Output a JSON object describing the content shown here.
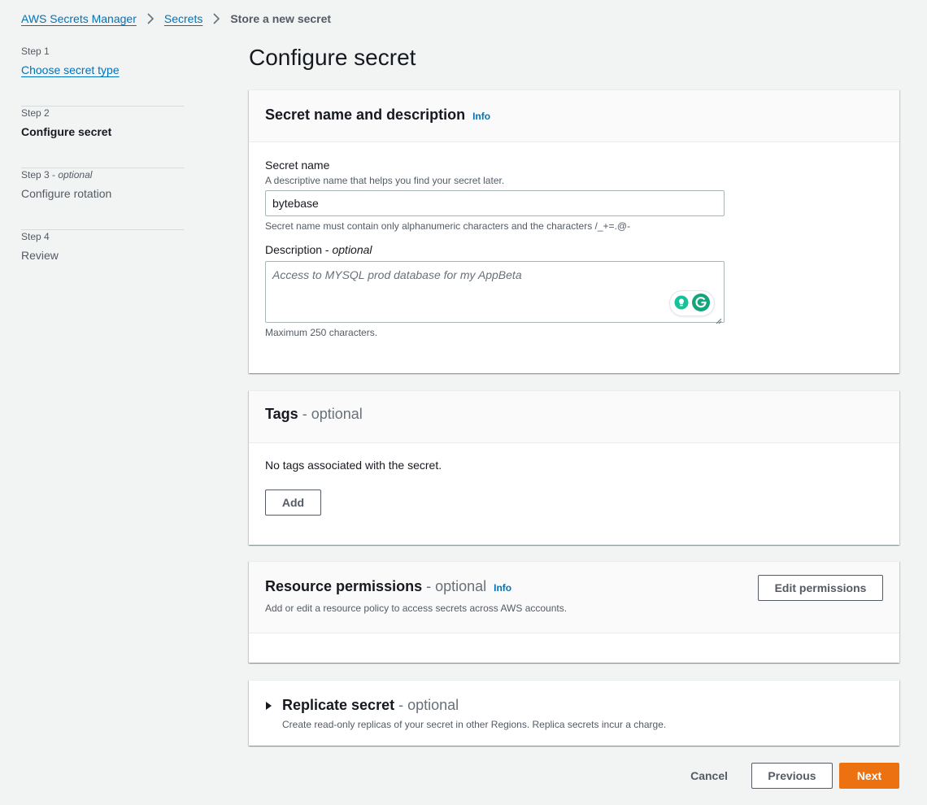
{
  "breadcrumb": {
    "root": "AWS Secrets Manager",
    "secrets": "Secrets",
    "current": "Store a new secret"
  },
  "steps": [
    {
      "label": "Step 1",
      "optional": "",
      "title": "Choose secret type"
    },
    {
      "label": "Step 2",
      "optional": "",
      "title": "Configure secret"
    },
    {
      "label": "Step 3",
      "optional": "optional",
      "title": "Configure rotation"
    },
    {
      "label": "Step 4",
      "optional": "",
      "title": "Review"
    }
  ],
  "page": {
    "title": "Configure secret"
  },
  "secret_name_panel": {
    "title": "Secret name and description",
    "info": "Info",
    "name_label": "Secret name",
    "name_desc": "A descriptive name that helps you find your secret later.",
    "name_value": "bytebase",
    "name_constraint": "Secret name must contain only alphanumeric characters and the characters /_+=.@-",
    "desc_label": "Description",
    "desc_optional": "optional",
    "desc_placeholder": "Access to MYSQL prod database for my AppBeta",
    "desc_constraint": "Maximum 250 characters."
  },
  "tags_panel": {
    "title": "Tags",
    "optional": "optional",
    "empty_text": "No tags associated with the secret.",
    "add_button": "Add"
  },
  "permissions_panel": {
    "title": "Resource permissions",
    "optional": "optional",
    "info": "Info",
    "description": "Add or edit a resource policy to access secrets across AWS accounts.",
    "edit_button": "Edit permissions"
  },
  "replicate_panel": {
    "title": "Replicate secret",
    "optional": "optional",
    "description": "Create read-only replicas of your secret in other Regions. Replica secrets incur a charge."
  },
  "footer": {
    "cancel": "Cancel",
    "previous": "Previous",
    "next": "Next"
  },
  "colors": {
    "link": "#0073bb",
    "primary": "#ec7211",
    "background": "#f2f3f3"
  },
  "icons": {
    "breadcrumb_separator": "chevron-right-icon",
    "expand": "caret-right-icon",
    "grammarly_suggest": "lightbulb-icon",
    "grammarly_logo": "grammarly-icon"
  }
}
